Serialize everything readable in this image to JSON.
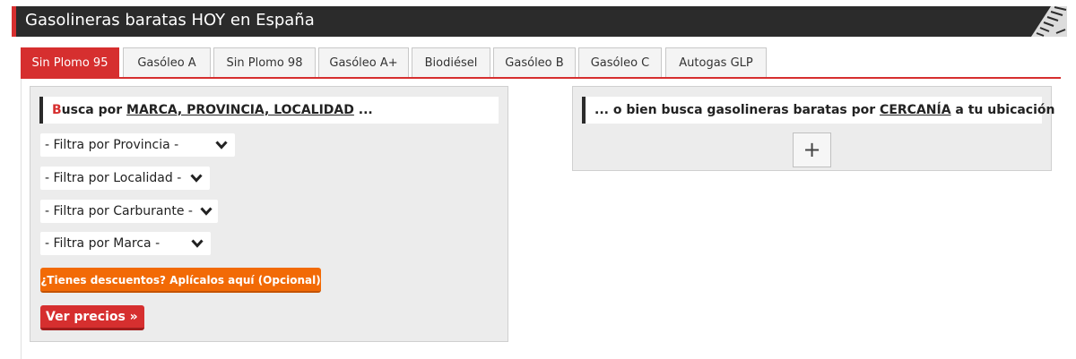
{
  "header": {
    "title": "Gasolineras baratas HOY en España"
  },
  "tabs": [
    {
      "label": "Sin Plomo 95",
      "active": true
    },
    {
      "label": "Gasóleo A",
      "active": false
    },
    {
      "label": "Sin Plomo 98",
      "active": false
    },
    {
      "label": "Gasóleo A+",
      "active": false
    },
    {
      "label": "Biodiésel",
      "active": false
    },
    {
      "label": "Gasóleo B",
      "active": false
    },
    {
      "label": "Gasóleo C",
      "active": false
    },
    {
      "label": "Autogas GLP",
      "active": false
    }
  ],
  "search_panel": {
    "heading_first_letter": "B",
    "heading_rest": "usca por ",
    "heading_link": "MARCA, PROVINCIA, LOCALIDAD",
    "heading_suffix": " ...",
    "filters": {
      "provincia": "- Filtra por Provincia -",
      "localidad": "- Filtra por Localidad -",
      "carburante": "- Filtra por Carburante -",
      "marca": "- Filtra por Marca -"
    },
    "discount_button": "¿Tienes descuentos? Aplícalos aquí (Opcional)",
    "prices_button": "Ver precios »"
  },
  "nearby_panel": {
    "heading_prefix": "... o bien busca gasolineras baratas por ",
    "heading_link": "CERCANÍA",
    "heading_suffix": " a tu ubicación",
    "expand_symbol": "+"
  },
  "colors": {
    "accent_red": "#d62f2f",
    "orange": "#f26a06",
    "header_dark": "#2b2b2b"
  }
}
